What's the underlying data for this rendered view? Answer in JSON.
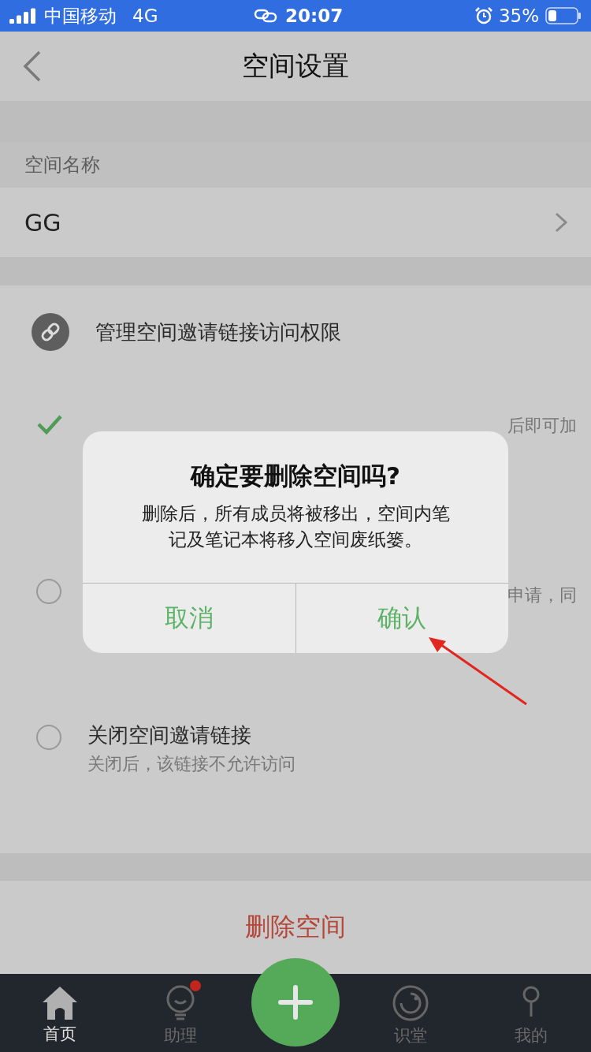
{
  "status_bar": {
    "carrier": "中国移动",
    "network": "4G",
    "time": "20:07",
    "battery_percent": "35%"
  },
  "nav": {
    "title": "空间设置"
  },
  "space_name": {
    "label": "空间名称",
    "value": "GG"
  },
  "invite": {
    "title": "管理空间邀请链接访问权限",
    "options": [
      {
        "kind": "check",
        "selected": true,
        "subtitle": "后即可加"
      },
      {
        "kind": "radio",
        "selected": false,
        "subtitle": "申请，同"
      },
      {
        "kind": "radio",
        "selected": false,
        "title": "关闭空间邀请链接",
        "subtitle": "关闭后，该链接不允许访问"
      }
    ]
  },
  "delete_button": "删除空间",
  "tabs": [
    {
      "kind": "home",
      "label": "首页",
      "selected": true,
      "badge": false
    },
    {
      "kind": "bulb",
      "label": "助理",
      "selected": false,
      "badge": true
    },
    {
      "kind": "plus"
    },
    {
      "kind": "smile",
      "label": "识堂",
      "selected": false,
      "badge": false
    },
    {
      "kind": "person",
      "label": "我的",
      "selected": false,
      "badge": false
    }
  ],
  "dialog": {
    "title": "确定要删除空间吗?",
    "message": "删除后，所有成员将被移出，空间内笔记及笔记本将移入空间废纸篓。",
    "buttons": [
      "取消",
      "确认"
    ]
  }
}
